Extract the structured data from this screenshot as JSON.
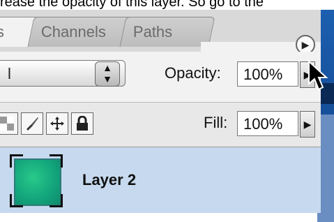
{
  "caption": "rease the opacity of this layer. So go to the",
  "tabs": [
    {
      "label": "s"
    },
    {
      "label": "Channels"
    },
    {
      "label": "Paths"
    }
  ],
  "blend_mode": {
    "value": "l"
  },
  "opacity": {
    "label": "Opacity:",
    "value": "100%"
  },
  "fill": {
    "label": "Fill:",
    "value": "100%"
  },
  "layer": {
    "name": "Layer 2"
  },
  "colors": {
    "accent_row": "#c6d9ee",
    "thumb": "#12a37b"
  },
  "icons": [
    "panel-menu-icon",
    "stepper-icon",
    "arrow-right-icon",
    "lock-transparency-icon",
    "brush-icon",
    "move-icon",
    "lock-icon",
    "cursor-icon"
  ]
}
